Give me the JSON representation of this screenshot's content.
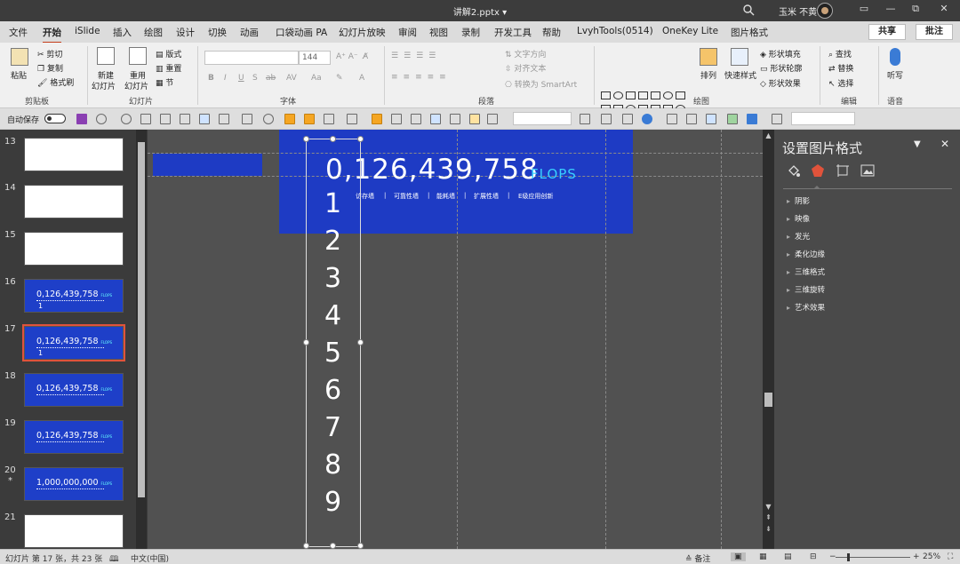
{
  "titlebar": {
    "doc": "讲解2.pptx ▾",
    "user": "玉米 不黄",
    "min": "—",
    "restore": "⧉",
    "close": "✕",
    "ribbon_opts": "▭"
  },
  "tabs": [
    "文件",
    "开始",
    "iSlide",
    "插入",
    "绘图",
    "设计",
    "切换",
    "动画",
    "口袋动画 PA",
    "幻灯片放映",
    "审阅",
    "视图",
    "录制",
    "开发工具",
    "帮助",
    "LvyhTools(0514)",
    "OneKey Lite",
    "图片格式"
  ],
  "active_tab": "开始",
  "share_label": "共享",
  "comment_label": "批注",
  "clipboard": {
    "paste": "粘贴",
    "cut": "剪切",
    "copy": "复制",
    "format_painter": "格式刷",
    "label": "剪贴板"
  },
  "slides_group": {
    "new": "新建",
    "new2": "幻灯片",
    "reuse": "重用",
    "reuse2": "幻灯片",
    "layout": "版式",
    "reset": "重置",
    "section": "节",
    "label": "幻灯片"
  },
  "font_group": {
    "size": "144",
    "label": "字体",
    "b": "B",
    "i": "I",
    "u": "U",
    "s": "S",
    "ab": "ab"
  },
  "para_group": {
    "text_dir": "文字方向",
    "align_text": "对齐文本",
    "smartart": "转换为 SmartArt",
    "label": "段落"
  },
  "draw_group": {
    "arrange": "排列",
    "quick": "快速样式",
    "fill": "形状填充",
    "outline": "形状轮廓",
    "effects": "形状效果",
    "label": "绘图"
  },
  "edit_group": {
    "find": "查找",
    "replace": "替换",
    "select": "选择",
    "label": "编辑"
  },
  "voice_group": {
    "dictate": "听写",
    "label": "语音"
  },
  "qat": {
    "autosave": "自动保存",
    "toggle": "关"
  },
  "thumbnails": [
    {
      "num": "13",
      "type": "white"
    },
    {
      "num": "14",
      "type": "white"
    },
    {
      "num": "15",
      "type": "white"
    },
    {
      "num": "16",
      "type": "blue",
      "text": "0,126,439,758",
      "sub": "FLOPS",
      "extra": "1"
    },
    {
      "num": "17",
      "type": "blue",
      "text": "0,126,439,758",
      "sub": "FLOPS",
      "extra": "1",
      "selected": true
    },
    {
      "num": "18",
      "type": "blue",
      "text": "0,126,439,758",
      "sub": "FLOPS"
    },
    {
      "num": "19",
      "type": "blue",
      "text": "0,126,439,758",
      "sub": "FLOPS"
    },
    {
      "num": "20",
      "type": "blue",
      "text": "1,000,000,000",
      "sub": "FLOPS",
      "star": "*"
    },
    {
      "num": "21",
      "type": "white"
    }
  ],
  "slide": {
    "number": "0,126,439,758",
    "unit": "FLOPS",
    "subs": [
      "访存墙",
      "可靠性墙",
      "能耗墙",
      "扩展性墙",
      "E级应用创新"
    ],
    "separator": "|",
    "digits": [
      "1",
      "2",
      "3",
      "4",
      "5",
      "6",
      "7",
      "8",
      "9"
    ]
  },
  "format_pane": {
    "title": "设置图片格式",
    "caret": "▼",
    "close": "✕",
    "sections": [
      "阴影",
      "映像",
      "发光",
      "柔化边缘",
      "三维格式",
      "三维旋转",
      "艺术效果"
    ]
  },
  "status": {
    "slide_info": "幻灯片 第 17 张，共 23 张",
    "lang": "中文(中国)",
    "notes": "备注",
    "zoom": "25%"
  },
  "colors": {
    "slide_blue": "#1e3bc4",
    "flops_cyan": "#39d0ff",
    "selection": "#e0533b"
  }
}
